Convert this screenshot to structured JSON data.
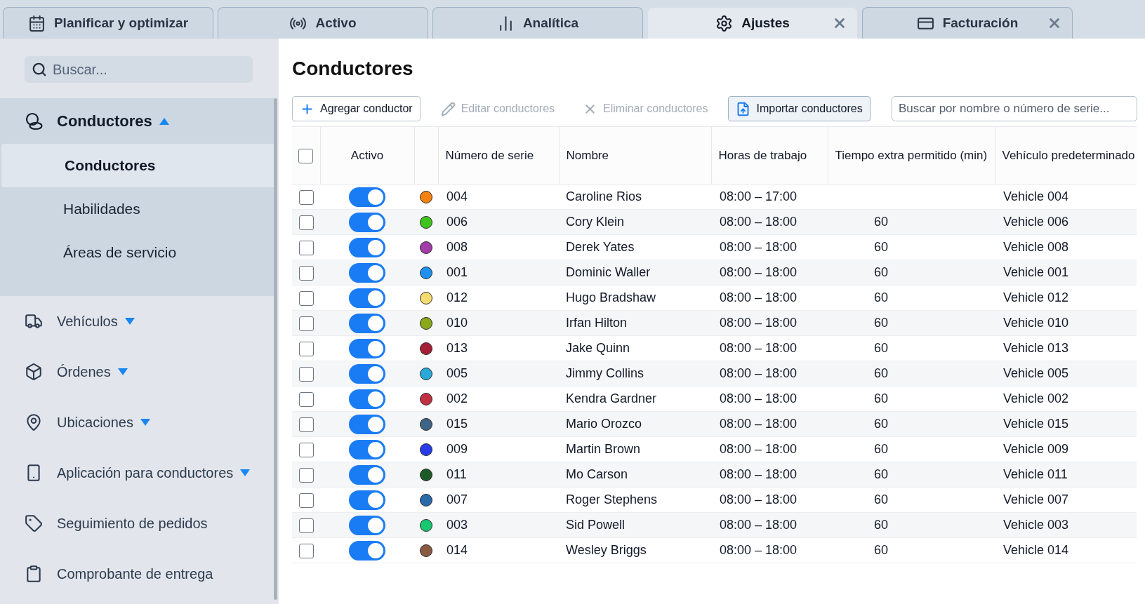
{
  "tabs": [
    {
      "label": "Planificar y optimizar",
      "selected": false,
      "closable": false
    },
    {
      "label": "Activo",
      "selected": false,
      "closable": false
    },
    {
      "label": "Analítica",
      "selected": false,
      "closable": false
    },
    {
      "label": "Ajustes",
      "selected": true,
      "closable": true
    },
    {
      "label": "Facturación",
      "selected": false,
      "closable": true
    }
  ],
  "sidebar": {
    "search": {
      "placeholder": "Buscar..."
    },
    "items": [
      {
        "label": "Conductores",
        "expanded": true,
        "children": [
          {
            "label": "Conductores",
            "selected": true
          },
          {
            "label": "Habilidades",
            "selected": false
          },
          {
            "label": "Áreas de servicio",
            "selected": false
          }
        ]
      },
      {
        "label": "Vehículos",
        "expanded": false
      },
      {
        "label": "Órdenes",
        "expanded": false
      },
      {
        "label": "Ubicaciones",
        "expanded": false
      },
      {
        "label": "Aplicación para conductores",
        "expanded": false
      },
      {
        "label": "Seguimiento de pedidos"
      },
      {
        "label": "Comprobante de entrega"
      }
    ]
  },
  "main": {
    "title": "Conductores",
    "toolbar": [
      {
        "label": "Agregar conductor",
        "disabled": false
      },
      {
        "label": "Editar conductores",
        "disabled": true
      },
      {
        "label": "Eliminar conductores",
        "disabled": true
      },
      {
        "label": "Importar conductores",
        "disabled": false
      }
    ],
    "search": {
      "placeholder": "Buscar por nombre o número de serie..."
    },
    "table": {
      "select_all": {
        "checked": false
      },
      "columns": [
        "Activo",
        "Número de serie",
        "Nombre",
        "Horas de trabajo",
        "Tiempo extra permitido (min)",
        "Vehículo predeterminado"
      ],
      "rows": [
        {
          "checked": false,
          "on": true,
          "color": "#f5820f",
          "serial": "004",
          "name": "Caroline Rios",
          "hours": "08:00 – 17:00",
          "vehicle": "Vehicle 004"
        },
        {
          "checked": false,
          "on": true,
          "color": "#3ec41c",
          "serial": "006",
          "name": "Cory Klein",
          "hours": "08:00 – 18:00",
          "overtime": "60",
          "vehicle": "Vehicle 006"
        },
        {
          "checked": false,
          "on": true,
          "color": "#a23ca8",
          "serial": "008",
          "name": "Derek Yates",
          "hours": "08:00 – 18:00",
          "overtime": "60",
          "vehicle": "Vehicle 008"
        },
        {
          "checked": false,
          "on": true,
          "color": "#1e90f0",
          "serial": "001",
          "name": "Dominic Waller",
          "hours": "08:00 – 18:00",
          "overtime": "60",
          "vehicle": "Vehicle 001"
        },
        {
          "checked": false,
          "on": true,
          "color": "#f5dc70",
          "serial": "012",
          "name": "Hugo Bradshaw",
          "hours": "08:00 – 18:00",
          "overtime": "60",
          "vehicle": "Vehicle 012"
        },
        {
          "checked": false,
          "on": true,
          "color": "#8aa818",
          "serial": "010",
          "name": "Irfan Hilton",
          "hours": "08:00 – 18:00",
          "overtime": "60",
          "vehicle": "Vehicle 010"
        },
        {
          "checked": false,
          "on": true,
          "color": "#a52035",
          "serial": "013",
          "name": "Jake Quinn",
          "hours": "08:00 – 18:00",
          "overtime": "60",
          "vehicle": "Vehicle 013"
        },
        {
          "checked": false,
          "on": true,
          "color": "#2aa8d8",
          "serial": "005",
          "name": "Jimmy Collins",
          "hours": "08:00 – 18:00",
          "overtime": "60",
          "vehicle": "Vehicle 005"
        },
        {
          "checked": false,
          "on": true,
          "color": "#c03040",
          "serial": "002",
          "name": "Kendra Gardner",
          "hours": "08:00 – 18:00",
          "overtime": "60",
          "vehicle": "Vehicle 002"
        },
        {
          "checked": false,
          "on": true,
          "color": "#3e6486",
          "serial": "015",
          "name": "Mario Orozco",
          "hours": "08:00 – 18:00",
          "overtime": "60",
          "vehicle": "Vehicle 015"
        },
        {
          "checked": false,
          "on": true,
          "color": "#2a3ce8",
          "serial": "009",
          "name": "Martin Brown",
          "hours": "08:00 – 18:00",
          "overtime": "60",
          "vehicle": "Vehicle 009"
        },
        {
          "checked": false,
          "on": true,
          "color": "#1e5a28",
          "serial": "011",
          "name": "Mo Carson",
          "hours": "08:00 – 18:00",
          "overtime": "60",
          "vehicle": "Vehicle 011"
        },
        {
          "checked": false,
          "on": true,
          "color": "#2a6aa8",
          "serial": "007",
          "name": "Roger Stephens",
          "hours": "08:00 – 18:00",
          "overtime": "60",
          "vehicle": "Vehicle 007"
        },
        {
          "checked": false,
          "on": true,
          "color": "#18c870",
          "serial": "003",
          "name": "Sid Powell",
          "hours": "08:00 – 18:00",
          "overtime": "60",
          "vehicle": "Vehicle 003"
        },
        {
          "checked": false,
          "on": true,
          "color": "#8a5a40",
          "serial": "014",
          "name": "Wesley Briggs",
          "hours": "08:00 – 18:00",
          "overtime": "60",
          "vehicle": "Vehicle 014"
        }
      ]
    }
  }
}
